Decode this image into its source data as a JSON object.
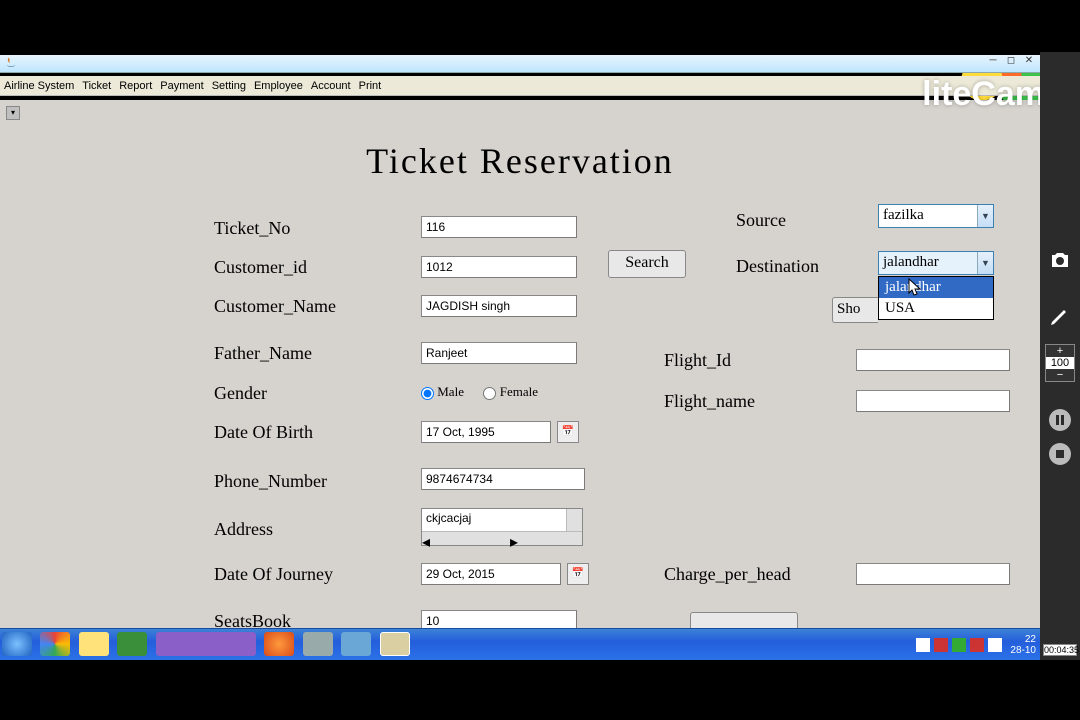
{
  "menu": [
    "Airline System",
    "Ticket",
    "Report",
    "Payment",
    "Setting",
    "Employee",
    "Account",
    "Print"
  ],
  "heading": "Ticket  Reservation",
  "labels": {
    "ticket_no": "Ticket_No",
    "customer_id": "Customer_id",
    "customer_name": "Customer_Name",
    "father_name": "Father_Name",
    "gender": "Gender",
    "dob": "Date Of Birth",
    "phone": "Phone_Number",
    "address": "Address",
    "doj": "Date Of Journey",
    "seats": "SeatsBook",
    "source": "Source",
    "destination": "Destination",
    "flight_id": "Flight_Id",
    "flight_name": "Flight_name",
    "charge": "Charge_per_head",
    "male": "Male",
    "female": "Female"
  },
  "values": {
    "ticket_no": "116",
    "customer_id": "1012",
    "customer_name": "JAGDISH singh",
    "father_name": "Ranjeet",
    "dob": "17 Oct, 1995",
    "phone": "9874674734",
    "address": "ckjcacjaj",
    "doj": "29 Oct, 2015",
    "seats": "10",
    "source": "fazilka",
    "destination": "jalandhar",
    "flight_id": "",
    "flight_name": "",
    "charge": ""
  },
  "dropdown_options": [
    "jalandhar",
    "USA"
  ],
  "buttons": {
    "search": "Search",
    "show_partial": "Sho"
  },
  "right_panel": {
    "zoom": "100",
    "timer": "00:04:35"
  },
  "watermark": "liteCam",
  "clock": {
    "time": "22",
    "date": "28-10"
  }
}
